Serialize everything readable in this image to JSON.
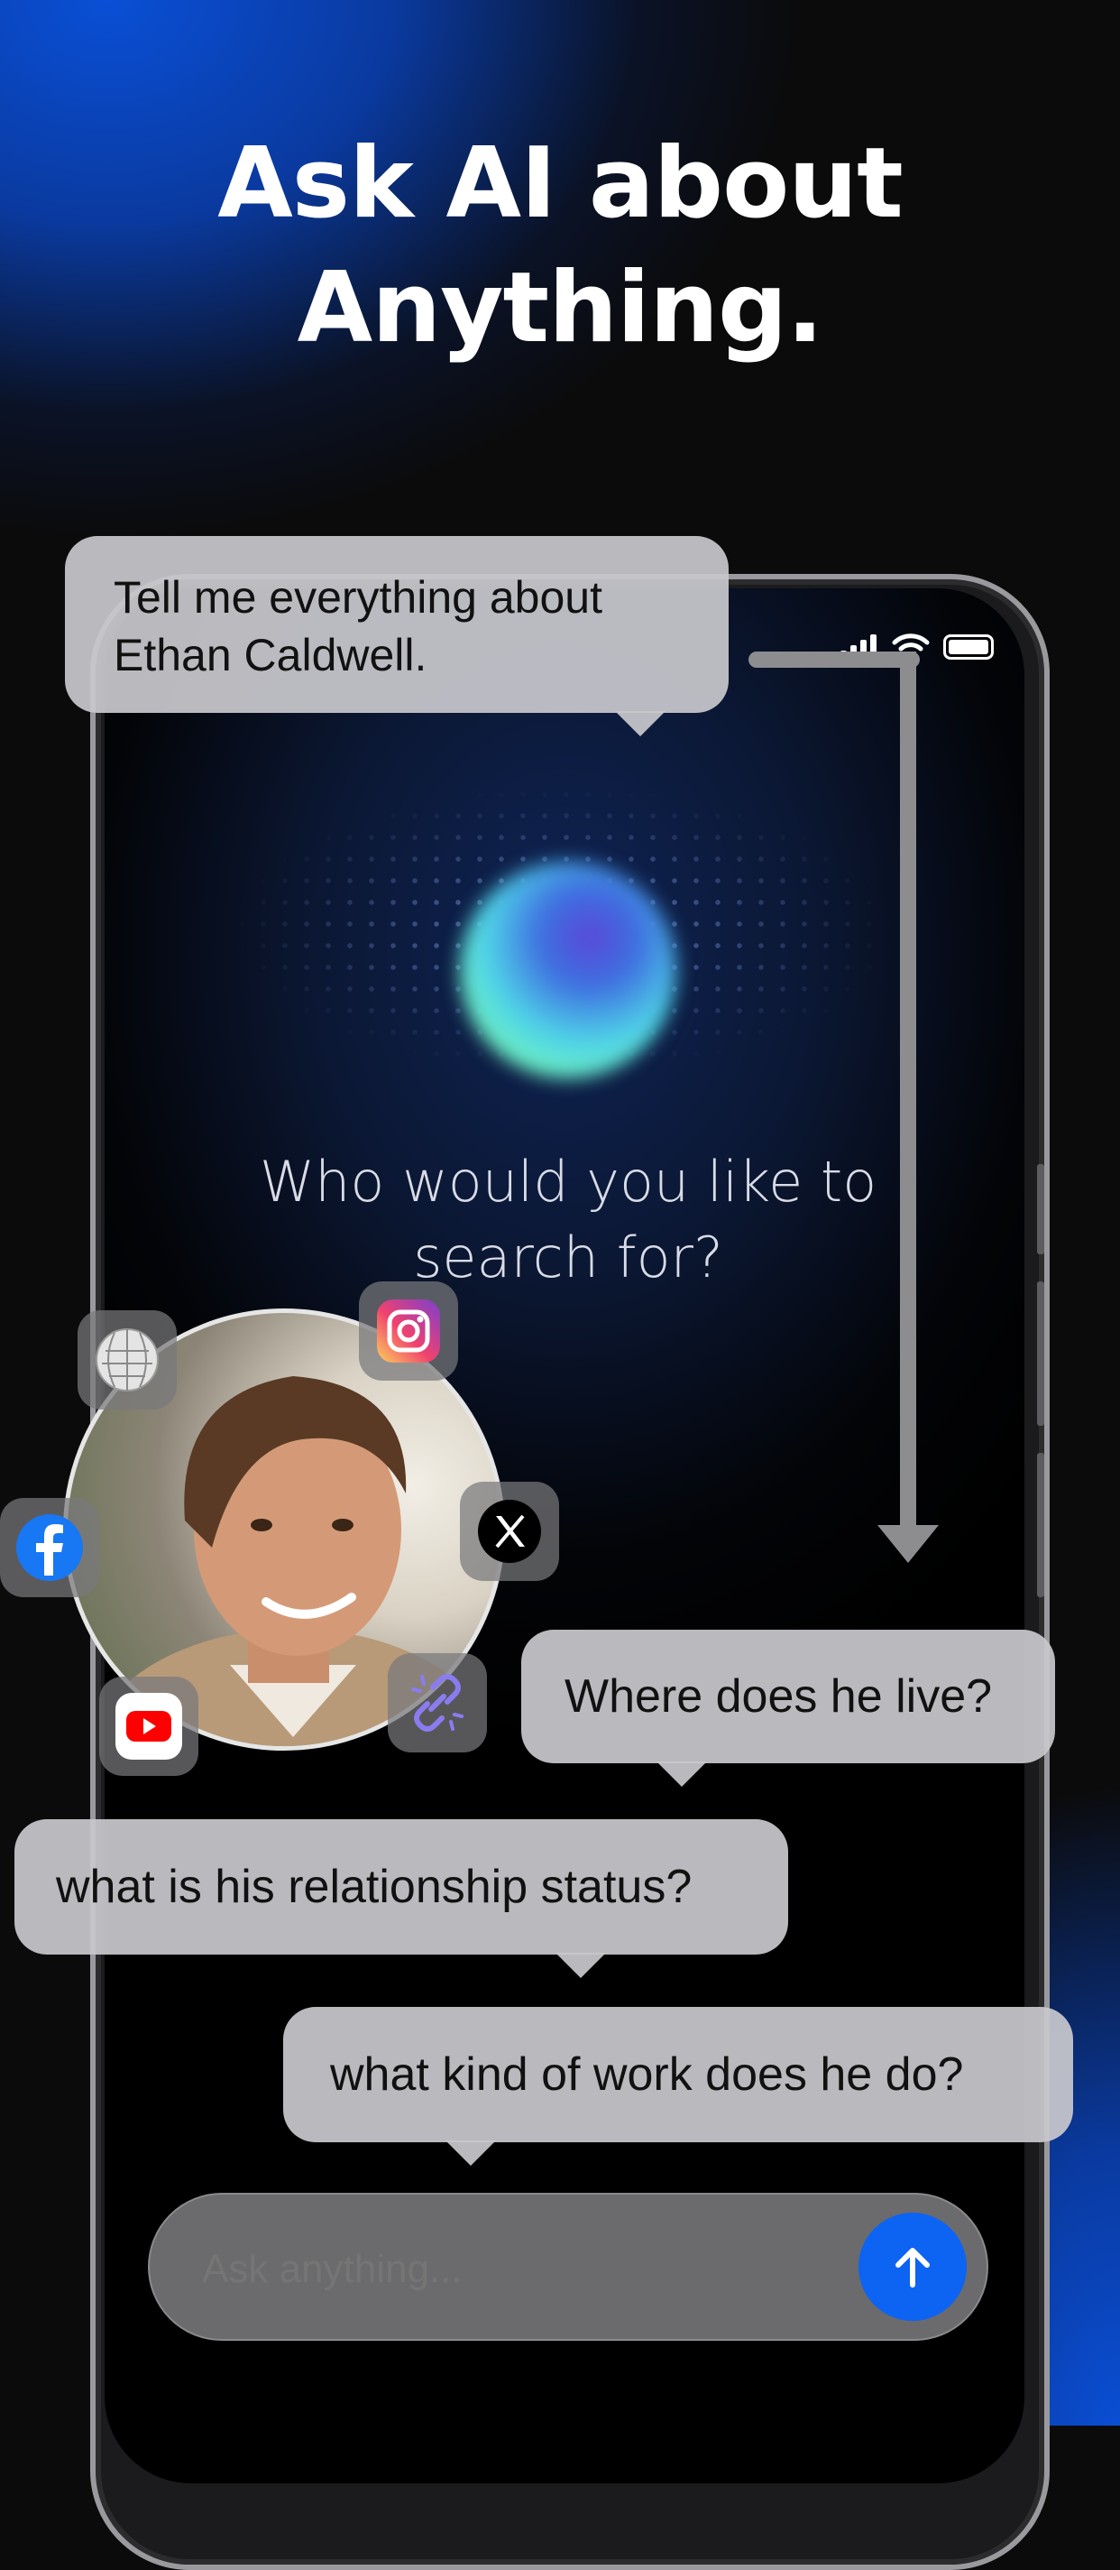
{
  "headline": {
    "line1": "Ask AI about",
    "line2": "Anything."
  },
  "screen": {
    "prompt": "Who would you like to search for?"
  },
  "chat": {
    "question_main": "Tell me everything about Ethan Caldwell.",
    "question_location": "Where does he live?",
    "question_relationship": "what is his relationship status?",
    "question_work": "what kind of work does he do?"
  },
  "input": {
    "placeholder": "Ask anything..."
  },
  "colors": {
    "accent": "#0d63f2",
    "background": "#0b0b0c",
    "glow": "#0a4fd6"
  },
  "icons": [
    "wikipedia-icon",
    "instagram-icon",
    "x-icon",
    "facebook-icon",
    "youtube-icon",
    "link-icon",
    "send-arrow-icon"
  ]
}
